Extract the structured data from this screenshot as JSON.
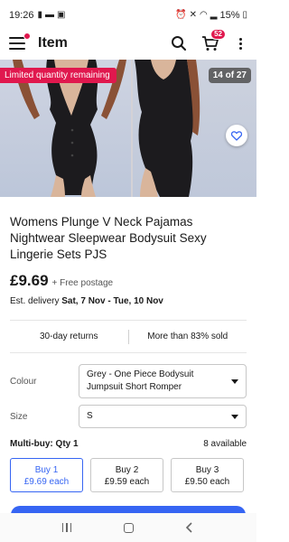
{
  "status_bar": {
    "time": "19:26",
    "battery": "15%",
    "left_icons": [
      "vibrate-icon",
      "message-icon",
      "image-icon"
    ],
    "right_icons": [
      "alarm-icon",
      "mute-icon",
      "wifi-icon",
      "signal-icon",
      "battery-icon"
    ]
  },
  "app_bar": {
    "title": "Item",
    "cart_count": "52"
  },
  "gallery": {
    "promo_label": "Limited quantity remaining",
    "counter": "14 of 27"
  },
  "product": {
    "title": "Womens Plunge V Neck Pajamas Nightwear Sleepwear Bodysuit Sexy Lingerie Sets PJS",
    "price": "£9.69",
    "postage": "+ Free postage",
    "delivery_prefix": "Est. delivery",
    "delivery_dates": "Sat, 7 Nov - Tue, 10 Nov"
  },
  "perks": {
    "returns": "30-day returns",
    "sold": "More than 83% sold"
  },
  "options": {
    "colour_label": "Colour",
    "colour_value": "Grey - One Piece Bodysuit Jumpsuit Short Romper",
    "size_label": "Size",
    "size_value": "S"
  },
  "multibuy": {
    "title": "Multi-buy: Qty 1",
    "available": "8 available",
    "options": [
      {
        "line1": "Buy 1",
        "line2": "£9.69 each"
      },
      {
        "line1": "Buy 2",
        "line2": "£9.59 each"
      },
      {
        "line1": "Buy 3",
        "line2": "£9.50 each"
      }
    ]
  },
  "colors": {
    "accent_blue": "#3665f3",
    "badge_red": "#e0184e"
  }
}
